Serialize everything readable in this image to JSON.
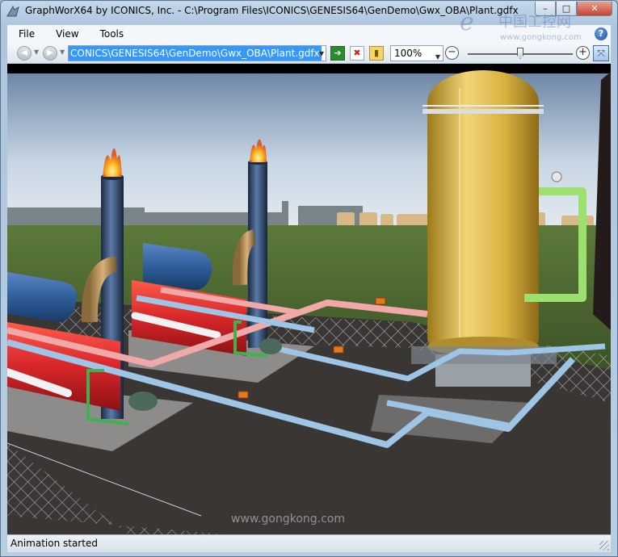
{
  "window": {
    "title": "GraphWorX64 by ICONICS, Inc. - C:\\Program Files\\ICONICS\\GENESIS64\\GenDemo\\Gwx_OBA\\Plant.gdfx"
  },
  "menu": {
    "items": [
      {
        "label": "File"
      },
      {
        "label": "View"
      },
      {
        "label": "Tools"
      }
    ]
  },
  "toolbar": {
    "address_value": "CONICS\\GENESIS64\\GenDemo\\Gwx_OBA\\Plant.gdfx",
    "zoom_value": "100%",
    "zoom_slider_level": 0.5
  },
  "status": {
    "text": "Animation started"
  },
  "watermark": {
    "top_cn": "中国工控网",
    "top_url": "www.gongkong.com",
    "bottom_url": "www.gongkong.com"
  },
  "colors": {
    "selection": "#3399ff",
    "tank": "#e0b94a",
    "boiler_red": "#d8262a",
    "boiler_blue": "#2f5f9a",
    "pipe_blue": "#9ec4e6",
    "pipe_pink": "#f0a8a8",
    "pipe_green": "#9ee070",
    "ground": "#3a3634"
  },
  "icons": {
    "app": "graphworx-app-icon",
    "back": "back-arrow-icon",
    "forward": "forward-arrow-icon",
    "go": "go-arrow-icon",
    "stop": "stop-x-icon",
    "favorites": "bookmark-icon",
    "zoom_out": "zoom-out-icon",
    "zoom_in": "zoom-in-icon",
    "fit": "fit-to-window-icon",
    "help": "help-icon"
  }
}
